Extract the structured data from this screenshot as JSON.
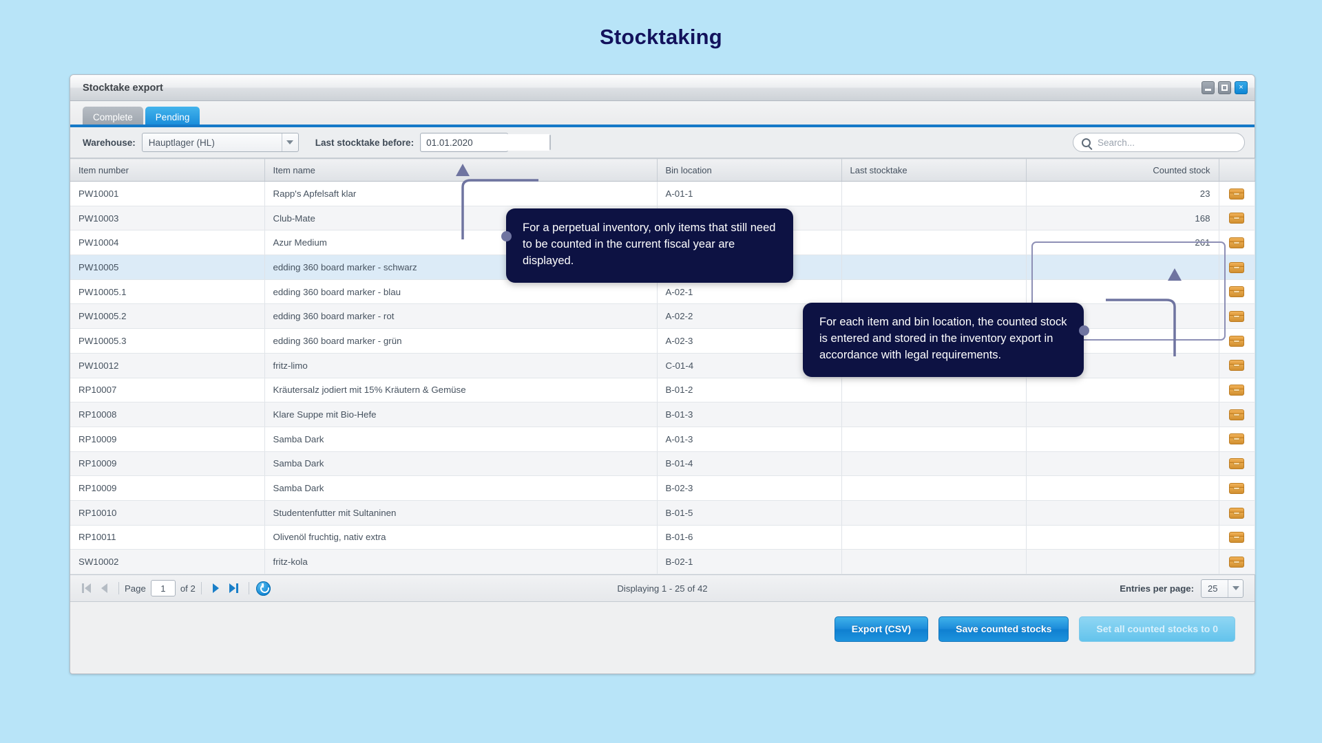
{
  "page": {
    "title": "Stocktaking"
  },
  "window": {
    "title": "Stocktake export",
    "controls": {
      "minimize": "minimize-icon",
      "maximize": "maximize-icon",
      "close": "×"
    }
  },
  "tabs": [
    {
      "label": "Complete",
      "active": false
    },
    {
      "label": "Pending",
      "active": true
    }
  ],
  "toolbar": {
    "warehouse_label": "Warehouse:",
    "warehouse_value": "Hauptlager (HL)",
    "last_stocktake_label": "Last stocktake before:",
    "last_stocktake_value": "01.01.2020",
    "calendar_icon": "calendar-icon",
    "search_placeholder": "Search...",
    "search_value": "",
    "search_icon": "search-icon"
  },
  "table": {
    "columns": [
      {
        "label": "Item number",
        "align": "left"
      },
      {
        "label": "Item name",
        "align": "left"
      },
      {
        "label": "Bin location",
        "align": "left"
      },
      {
        "label": "Last stocktake",
        "align": "left"
      },
      {
        "label": "Counted stock",
        "align": "right"
      },
      {
        "label": "",
        "align": "center"
      }
    ],
    "row_icon": "package-box-icon",
    "rows": [
      {
        "item_number": "PW10001",
        "item_name": "Rapp's Apfelsaft klar",
        "bin": "A-01-1",
        "last": "",
        "counted": "23"
      },
      {
        "item_number": "PW10003",
        "item_name": "Club-Mate",
        "bin": "",
        "last": "",
        "counted": "168"
      },
      {
        "item_number": "PW10004",
        "item_name": "Azur Medium",
        "bin": "",
        "last": "",
        "counted": "261"
      },
      {
        "item_number": "PW10005",
        "item_name": "edding 360 board marker - schwarz",
        "bin": "",
        "last": "",
        "counted": "",
        "selected": true
      },
      {
        "item_number": "PW10005.1",
        "item_name": "edding 360 board marker - blau",
        "bin": "A-02-1",
        "last": "",
        "counted": ""
      },
      {
        "item_number": "PW10005.2",
        "item_name": "edding 360 board marker - rot",
        "bin": "A-02-2",
        "last": "",
        "counted": ""
      },
      {
        "item_number": "PW10005.3",
        "item_name": "edding 360 board marker - grün",
        "bin": "A-02-3",
        "last": "",
        "counted": ""
      },
      {
        "item_number": "PW10012",
        "item_name": "fritz-limo",
        "bin": "C-01-4",
        "last": "",
        "counted": ""
      },
      {
        "item_number": "RP10007",
        "item_name": "Kräutersalz jodiert mit 15% Kräutern & Gemüse",
        "bin": "B-01-2",
        "last": "",
        "counted": ""
      },
      {
        "item_number": "RP10008",
        "item_name": "Klare Suppe mit Bio-Hefe",
        "bin": "B-01-3",
        "last": "",
        "counted": ""
      },
      {
        "item_number": "RP10009",
        "item_name": "Samba Dark",
        "bin": "A-01-3",
        "last": "",
        "counted": ""
      },
      {
        "item_number": "RP10009",
        "item_name": "Samba Dark",
        "bin": "B-01-4",
        "last": "",
        "counted": ""
      },
      {
        "item_number": "RP10009",
        "item_name": "Samba Dark",
        "bin": "B-02-3",
        "last": "",
        "counted": ""
      },
      {
        "item_number": "RP10010",
        "item_name": "Studentenfutter mit Sultaninen",
        "bin": "B-01-5",
        "last": "",
        "counted": ""
      },
      {
        "item_number": "RP10011",
        "item_name": "Olivenöl fruchtig, nativ extra",
        "bin": "B-01-6",
        "last": "",
        "counted": ""
      },
      {
        "item_number": "SW10002",
        "item_name": "fritz-kola",
        "bin": "B-02-1",
        "last": "",
        "counted": ""
      }
    ]
  },
  "pager": {
    "first_icon": "first-page-icon",
    "prev_icon": "previous-page-icon",
    "page_label": "Page",
    "page_value": "1",
    "of_label": "of 2",
    "next_icon": "next-page-icon",
    "last_icon": "last-page-icon",
    "refresh_icon": "refresh-icon",
    "status": "Displaying 1 - 25 of 42",
    "entries_label": "Entries per page:",
    "entries_value": "25"
  },
  "footer": {
    "export_label": "Export (CSV)",
    "save_label": "Save counted stocks",
    "reset_label": "Set all counted stocks to 0"
  },
  "callouts": [
    {
      "text": "For a perpetual inventory, only items that still need to be counted in the current fiscal year are displayed."
    },
    {
      "text": "For each item and bin location, the counted stock is entered and stored in the inventory export in accordance with legal requirements."
    }
  ],
  "colors": {
    "page_background": "#b8e4f8",
    "accent_blue": "#1579c8",
    "callout_bg": "#0d1243",
    "highlight_outline": "#8d8fb5",
    "selected_row": "#dcebf7"
  }
}
